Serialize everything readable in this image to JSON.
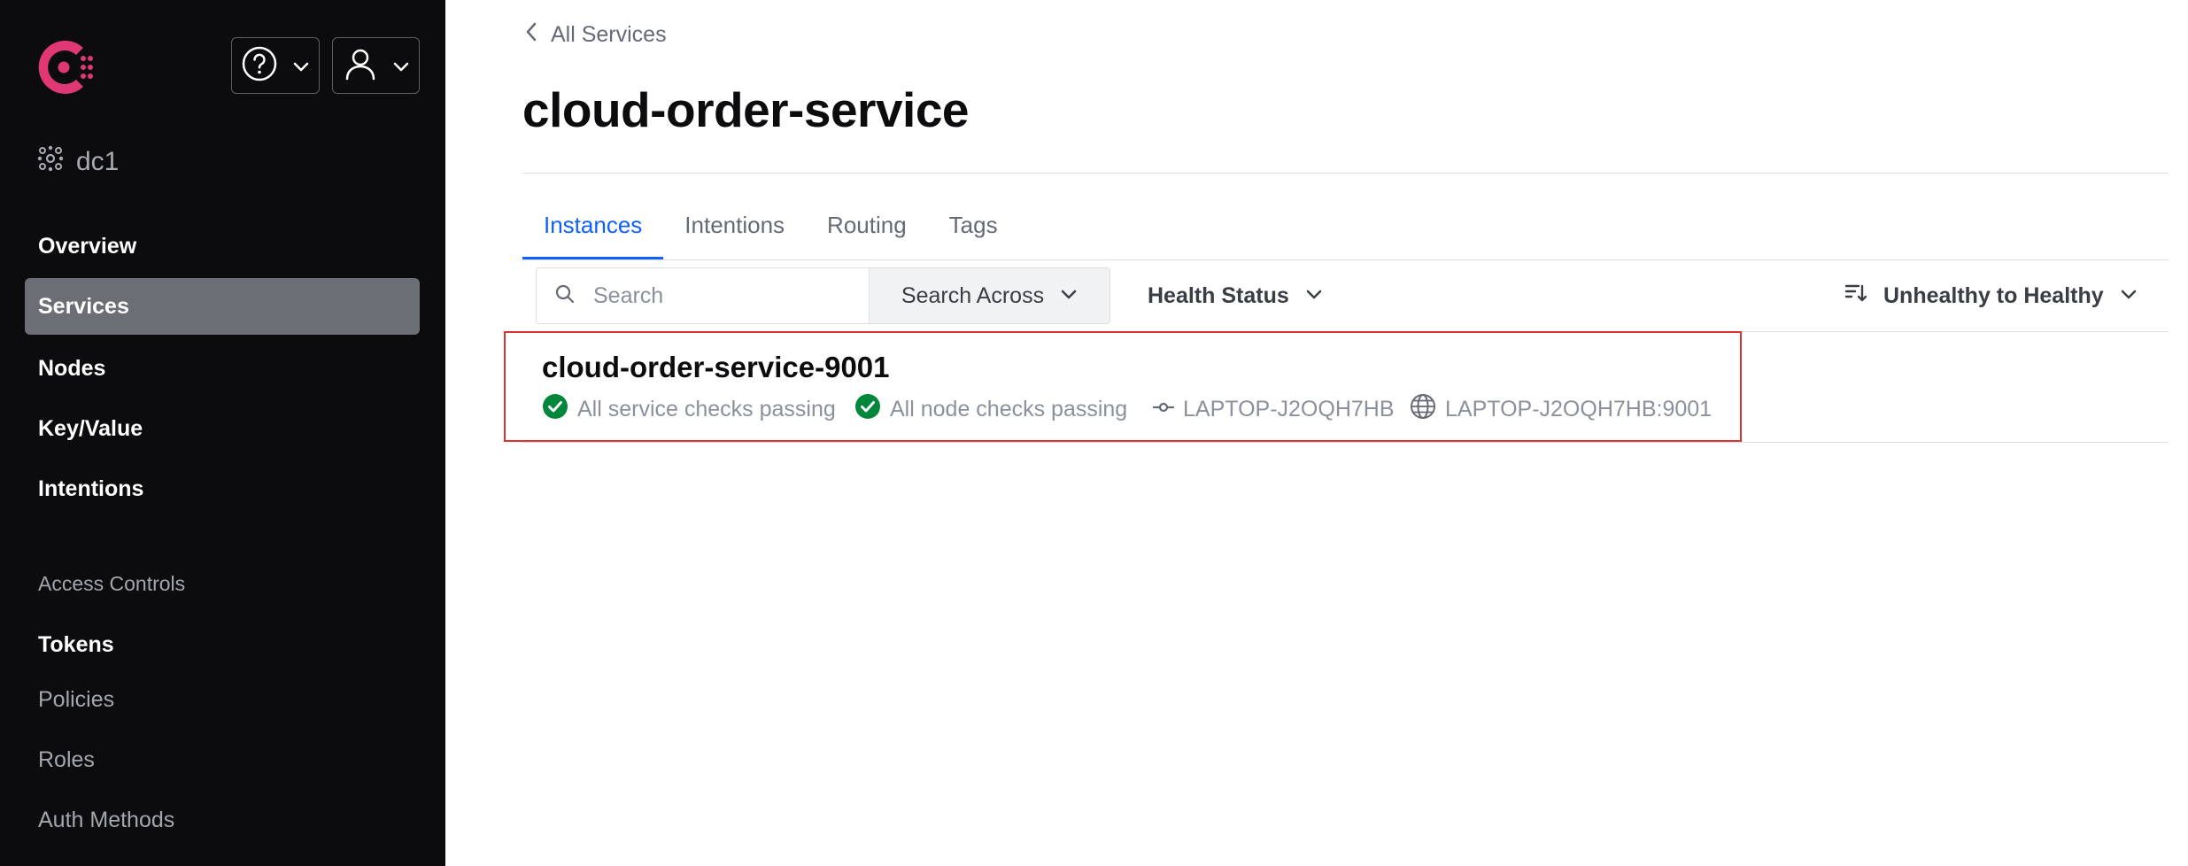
{
  "sidebar": {
    "datacenter": "dc1",
    "nav": [
      {
        "label": "Overview",
        "active": false
      },
      {
        "label": "Services",
        "active": true
      },
      {
        "label": "Nodes",
        "active": false
      },
      {
        "label": "Key/Value",
        "active": false
      },
      {
        "label": "Intentions",
        "active": false
      }
    ],
    "access_controls": {
      "heading": "Access Controls",
      "items": [
        {
          "label": "Tokens",
          "active": true
        },
        {
          "label": "Policies",
          "active": false
        },
        {
          "label": "Roles",
          "active": false
        },
        {
          "label": "Auth Methods",
          "active": false
        }
      ]
    }
  },
  "header": {
    "back_label": "All Services",
    "title": "cloud-order-service"
  },
  "tabs": [
    {
      "label": "Instances",
      "active": true
    },
    {
      "label": "Intentions",
      "active": false
    },
    {
      "label": "Routing",
      "active": false
    },
    {
      "label": "Tags",
      "active": false
    }
  ],
  "toolbar": {
    "search_placeholder": "Search",
    "search_across_label": "Search Across",
    "health_status_label": "Health Status",
    "sort_label": "Unhealthy to Healthy"
  },
  "instances": [
    {
      "name": "cloud-order-service-9001",
      "service_checks": "All service checks passing",
      "node_checks": "All node checks passing",
      "node": "LAPTOP-J2OQH7HB",
      "address": "LAPTOP-J2OQH7HB:9001"
    }
  ],
  "colors": {
    "brand": "#e03875",
    "accent": "#1060ff",
    "passing": "#00873b",
    "highlight_border": "#e03131"
  }
}
